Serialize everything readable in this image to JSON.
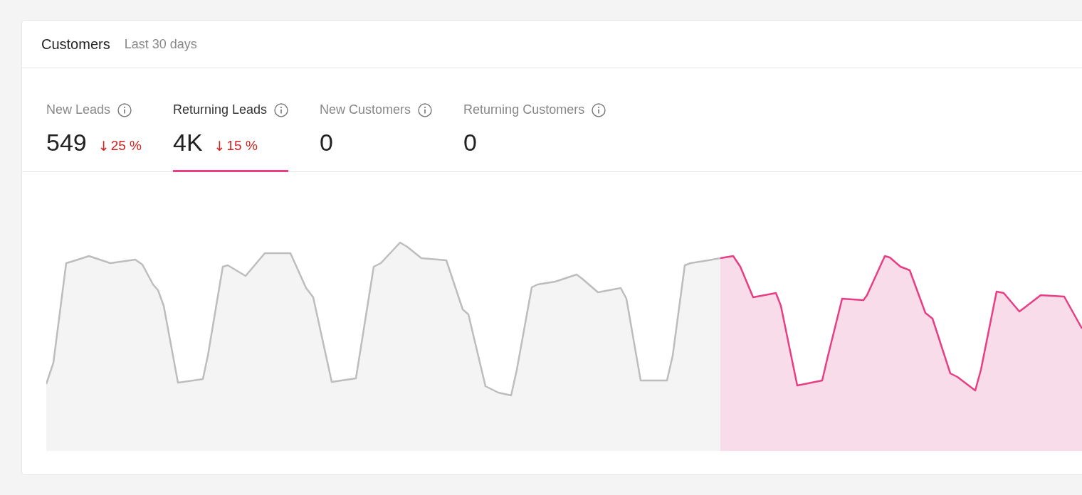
{
  "card": {
    "title": "Customers",
    "subtitle": "Last 30 days"
  },
  "metrics": [
    {
      "label": "New Leads",
      "value": "549",
      "arrow": "↓",
      "change": "25 %",
      "selected": false
    },
    {
      "label": "Returning Leads",
      "value": "4K",
      "arrow": "↓",
      "change": "15 %",
      "selected": true
    },
    {
      "label": "New Customers",
      "value": "0",
      "selected": false
    },
    {
      "label": "Returning Customers",
      "value": "0",
      "selected": false
    }
  ]
}
